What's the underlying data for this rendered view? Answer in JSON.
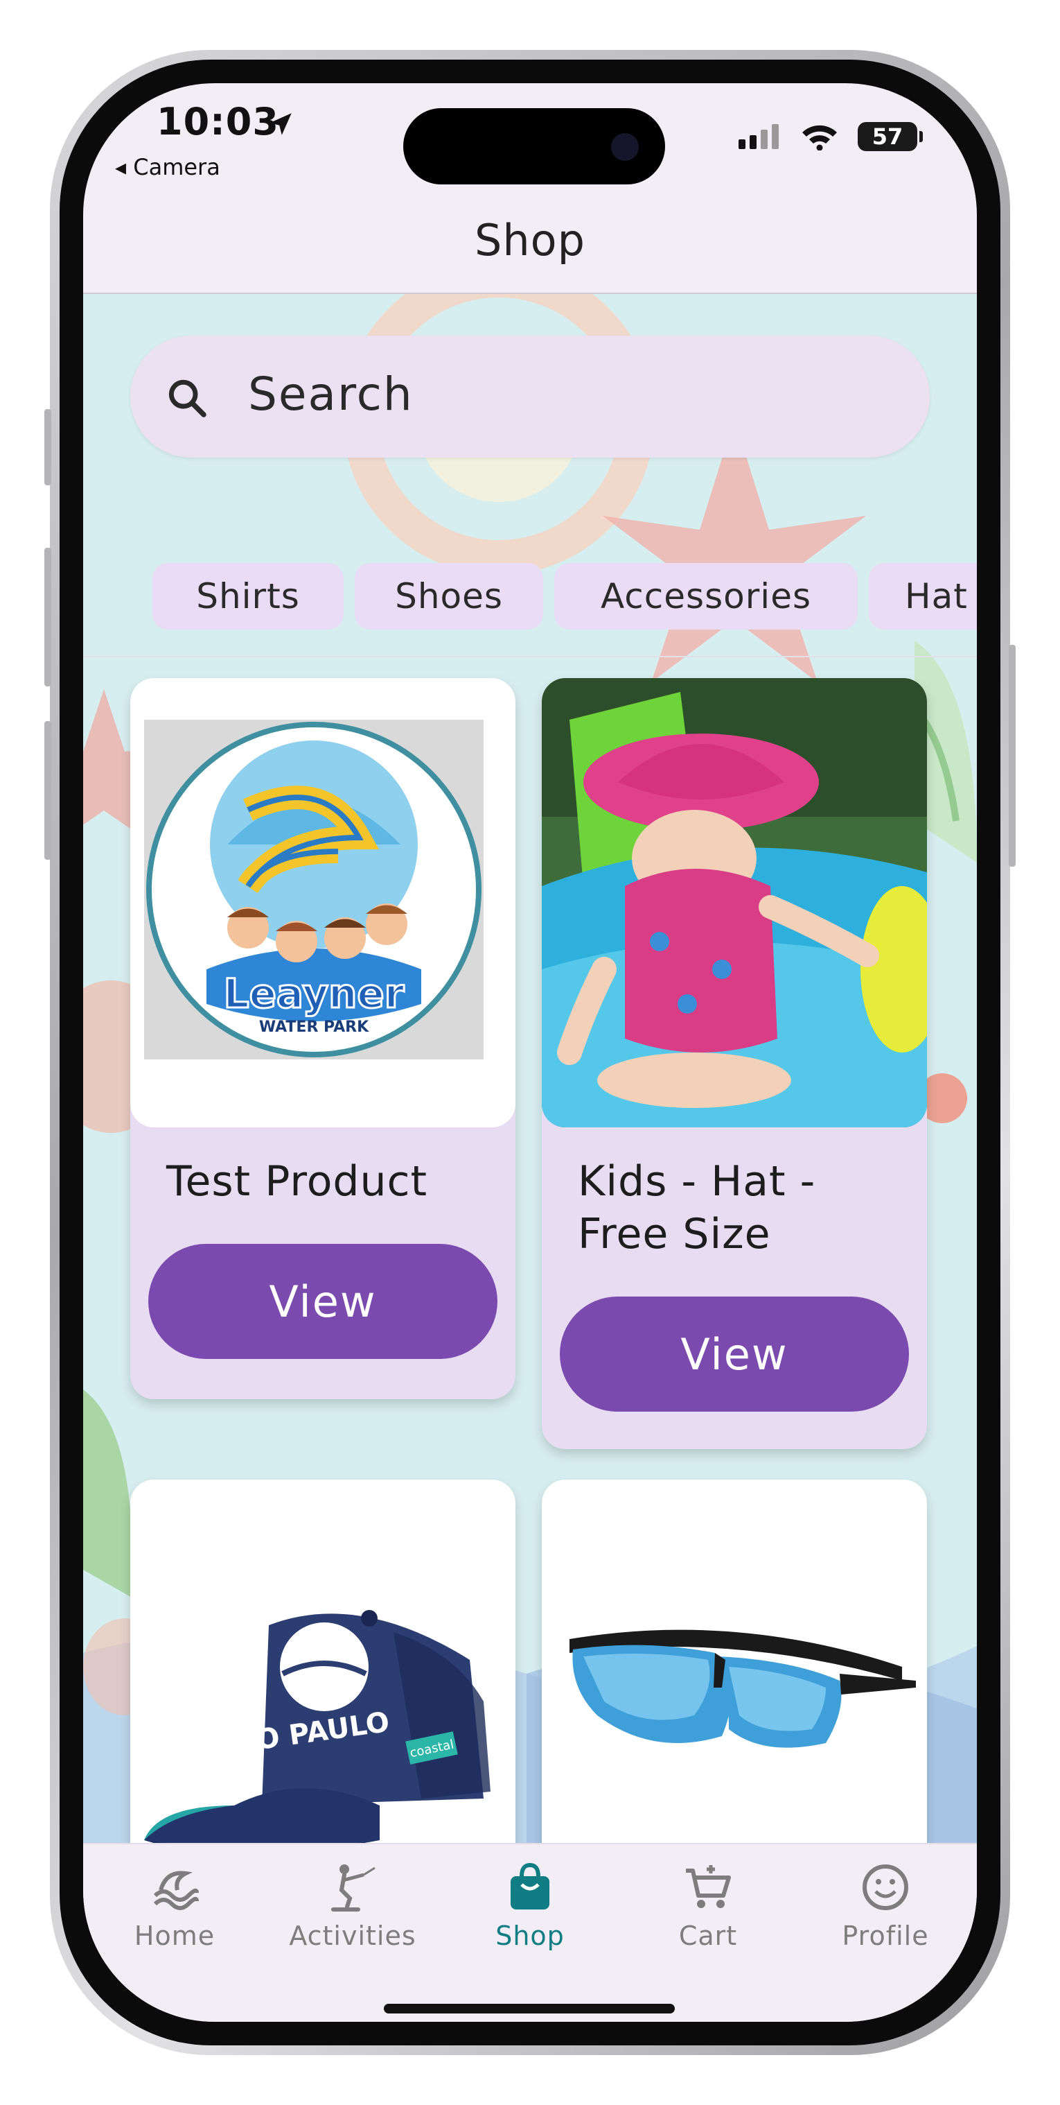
{
  "status_bar": {
    "time": "10:03",
    "back_label": "◂ Camera",
    "battery": "57"
  },
  "header": {
    "title": "Shop"
  },
  "search": {
    "placeholder": "Search"
  },
  "categories": [
    "Shirts",
    "Shoes",
    "Accessories",
    "Hat"
  ],
  "products": [
    {
      "name": "Test Product",
      "button": "View",
      "image": "waterpark-logo",
      "logo_text": "Leayner",
      "logo_subtext": "WATER PARK"
    },
    {
      "name_line1": "Kids - Hat -",
      "name_line2": "Free Size",
      "button": "View",
      "image": "kid-in-sun-hat"
    },
    {
      "image": "navy-trucker-cap",
      "cap_text": "SÃO PAULO",
      "cap_tag": "coastal"
    },
    {
      "image": "blue-mirror-sunglasses"
    }
  ],
  "nav": {
    "items": [
      {
        "label": "Home",
        "icon": "wave-icon"
      },
      {
        "label": "Activities",
        "icon": "waterski-icon"
      },
      {
        "label": "Shop",
        "icon": "shopping-bag-icon",
        "active": true
      },
      {
        "label": "Cart",
        "icon": "cart-icon"
      },
      {
        "label": "Profile",
        "icon": "smiley-icon"
      }
    ]
  },
  "colors": {
    "accent": "#7a4aaf",
    "active_nav": "#0f7d83",
    "card_bg": "#e7dcf2",
    "chip_bg": "#eadcf4",
    "background": "#d7eef0"
  }
}
